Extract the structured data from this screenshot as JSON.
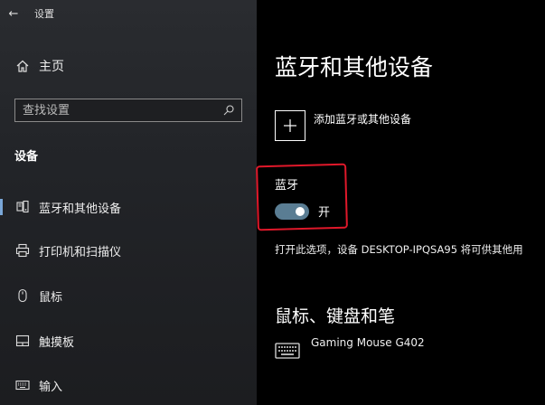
{
  "window": {
    "back_glyph": "←",
    "title": "设置"
  },
  "sidebar": {
    "home_label": "主页",
    "search_placeholder": "查找设置",
    "section_label": "设备",
    "items": [
      {
        "label": "蓝牙和其他设备",
        "icon": "bluetooth-devices-icon",
        "selected": true
      },
      {
        "label": "打印机和扫描仪",
        "icon": "printer-icon",
        "selected": false
      },
      {
        "label": "鼠标",
        "icon": "mouse-icon",
        "selected": false
      },
      {
        "label": "触摸板",
        "icon": "touchpad-icon",
        "selected": false
      },
      {
        "label": "输入",
        "icon": "keyboard-icon",
        "selected": false
      }
    ]
  },
  "main": {
    "title": "蓝牙和其他设备",
    "add_device_label": "添加蓝牙或其他设备",
    "bluetooth_label": "蓝牙",
    "bluetooth_toggle_state": "开",
    "bluetooth_on": true,
    "description": "打开此选项，设备 DESKTOP-IPQSA95 将可供其他用",
    "mouse_section_title": "鼠标、键盘和笔",
    "devices": [
      {
        "name": "Gaming Mouse G402",
        "icon": "keyboard-icon"
      }
    ]
  },
  "colors": {
    "accent": "#7aa7d8",
    "toggle_on": "#5a7d93",
    "annotation_red": "#e0182a"
  }
}
